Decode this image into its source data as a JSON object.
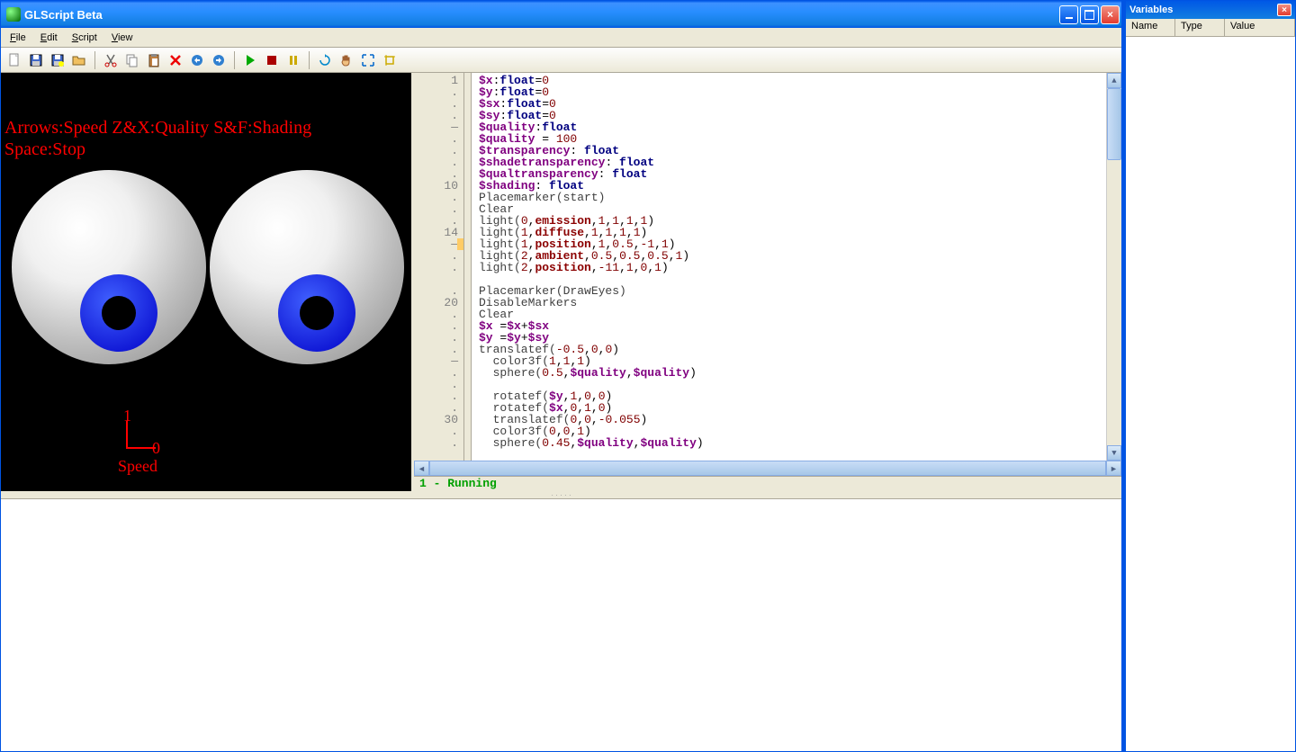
{
  "title": "GLScript Beta",
  "menu": {
    "file": "File",
    "edit": "Edit",
    "script": "Script",
    "view": "View"
  },
  "overlay": {
    "line1": "Arrows:Speed  Z&X:Quality   S&F:Shading",
    "line2": "Space:Stop",
    "axis_y": "1",
    "axis_x": "0",
    "axis_label": "Speed"
  },
  "gutter": [
    "1",
    ".",
    ".",
    ".",
    "—",
    ".",
    ".",
    ".",
    ".",
    "10",
    ".",
    ".",
    ".",
    "14",
    "—",
    ".",
    ".",
    "",
    ".",
    "20",
    ".",
    ".",
    ".",
    ".",
    "—",
    ".",
    ".",
    ".",
    ".",
    "30",
    ".",
    "."
  ],
  "codeLines": [
    [
      [
        "k-var",
        "$x"
      ],
      [
        "",
        ":"
      ],
      [
        "k-type",
        "float"
      ],
      [
        "",
        "="
      ],
      [
        "k-num",
        "0"
      ]
    ],
    [
      [
        "k-var",
        "$y"
      ],
      [
        "",
        ":"
      ],
      [
        "k-type",
        "float"
      ],
      [
        "",
        "="
      ],
      [
        "k-num",
        "0"
      ]
    ],
    [
      [
        "k-var",
        "$sx"
      ],
      [
        "",
        ":"
      ],
      [
        "k-type",
        "float"
      ],
      [
        "",
        "="
      ],
      [
        "k-num",
        "0"
      ]
    ],
    [
      [
        "k-var",
        "$sy"
      ],
      [
        "",
        ":"
      ],
      [
        "k-type",
        "float"
      ],
      [
        "",
        "="
      ],
      [
        "k-num",
        "0"
      ]
    ],
    [
      [
        "k-var",
        "$quality"
      ],
      [
        "",
        ":"
      ],
      [
        "k-type",
        "float"
      ]
    ],
    [
      [
        "k-var",
        "$quality"
      ],
      [
        "",
        " = "
      ],
      [
        "k-num",
        "100"
      ]
    ],
    [
      [
        "k-var",
        "$transparency"
      ],
      [
        "",
        ": "
      ],
      [
        "k-type",
        "float"
      ]
    ],
    [
      [
        "k-var",
        "$shadetransparency"
      ],
      [
        "",
        ": "
      ],
      [
        "k-type",
        "float"
      ]
    ],
    [
      [
        "k-var",
        "$qualtransparency"
      ],
      [
        "",
        ": "
      ],
      [
        "k-type",
        "float"
      ]
    ],
    [
      [
        "k-var",
        "$shading"
      ],
      [
        "",
        ": "
      ],
      [
        "k-type",
        "float"
      ]
    ],
    [
      [
        "k-id",
        "Placemarker(start)"
      ]
    ],
    [
      [
        "k-id",
        "Clear"
      ]
    ],
    [
      [
        "k-id",
        "light("
      ],
      [
        "k-num",
        "0"
      ],
      [
        "",
        ","
      ],
      [
        "k-kw",
        "emission"
      ],
      [
        "",
        ","
      ],
      [
        "k-num",
        "1"
      ],
      [
        "",
        ","
      ],
      [
        "k-num",
        "1"
      ],
      [
        "",
        ","
      ],
      [
        "k-num",
        "1"
      ],
      [
        "",
        ","
      ],
      [
        "k-num",
        "1"
      ],
      [
        "",
        ")"
      ]
    ],
    [
      [
        "k-id",
        "light("
      ],
      [
        "k-num",
        "1"
      ],
      [
        "",
        ","
      ],
      [
        "k-kw",
        "diffuse"
      ],
      [
        "",
        ","
      ],
      [
        "k-num",
        "1"
      ],
      [
        "",
        ","
      ],
      [
        "k-num",
        "1"
      ],
      [
        "",
        ","
      ],
      [
        "k-num",
        "1"
      ],
      [
        "",
        ","
      ],
      [
        "k-num",
        "1"
      ],
      [
        "",
        ")"
      ]
    ],
    [
      [
        "k-id",
        "light("
      ],
      [
        "k-num",
        "1"
      ],
      [
        "",
        ","
      ],
      [
        "k-kw",
        "position"
      ],
      [
        "",
        ","
      ],
      [
        "k-num",
        "1"
      ],
      [
        "",
        ","
      ],
      [
        "k-num",
        "0.5"
      ],
      [
        "",
        ","
      ],
      [
        "k-num",
        "-1"
      ],
      [
        "",
        ","
      ],
      [
        "k-num",
        "1"
      ],
      [
        "",
        ")"
      ]
    ],
    [
      [
        "k-id",
        "light("
      ],
      [
        "k-num",
        "2"
      ],
      [
        "",
        ","
      ],
      [
        "k-kw",
        "ambient"
      ],
      [
        "",
        ","
      ],
      [
        "k-num",
        "0.5"
      ],
      [
        "",
        ","
      ],
      [
        "k-num",
        "0.5"
      ],
      [
        "",
        ","
      ],
      [
        "k-num",
        "0.5"
      ],
      [
        "",
        ","
      ],
      [
        "k-num",
        "1"
      ],
      [
        "",
        ")"
      ]
    ],
    [
      [
        "k-id",
        "light("
      ],
      [
        "k-num",
        "2"
      ],
      [
        "",
        ","
      ],
      [
        "k-kw",
        "position"
      ],
      [
        "",
        ","
      ],
      [
        "k-num",
        "-11"
      ],
      [
        "",
        ","
      ],
      [
        "k-num",
        "1"
      ],
      [
        "",
        ","
      ],
      [
        "k-num",
        "0"
      ],
      [
        "",
        ","
      ],
      [
        "k-num",
        "1"
      ],
      [
        "",
        ")"
      ]
    ],
    [
      [
        "",
        ""
      ]
    ],
    [
      [
        "k-id",
        "Placemarker(DrawEyes)"
      ]
    ],
    [
      [
        "k-id",
        "DisableMarkers"
      ]
    ],
    [
      [
        "k-id",
        "Clear"
      ]
    ],
    [
      [
        "k-var",
        "$x"
      ],
      [
        "",
        " ="
      ],
      [
        "k-var",
        "$x"
      ],
      [
        "",
        "+"
      ],
      [
        "k-var",
        "$sx"
      ]
    ],
    [
      [
        "k-var",
        "$y"
      ],
      [
        "",
        " ="
      ],
      [
        "k-var",
        "$y"
      ],
      [
        "",
        "+"
      ],
      [
        "k-var",
        "$sy"
      ]
    ],
    [
      [
        "k-id",
        "translatef("
      ],
      [
        "k-num",
        "-0.5"
      ],
      [
        "",
        ","
      ],
      [
        "k-num",
        "0"
      ],
      [
        "",
        ","
      ],
      [
        "k-num",
        "0"
      ],
      [
        "",
        ")"
      ]
    ],
    [
      [
        "",
        "  "
      ],
      [
        "k-id",
        "color3f("
      ],
      [
        "k-num",
        "1"
      ],
      [
        "",
        ","
      ],
      [
        "k-num",
        "1"
      ],
      [
        "",
        ","
      ],
      [
        "k-num",
        "1"
      ],
      [
        "",
        ")"
      ]
    ],
    [
      [
        "",
        "  "
      ],
      [
        "k-id",
        "sphere("
      ],
      [
        "k-num",
        "0.5"
      ],
      [
        "",
        ","
      ],
      [
        "k-var",
        "$quality"
      ],
      [
        "",
        ","
      ],
      [
        "k-var",
        "$quality"
      ],
      [
        "",
        ")"
      ]
    ],
    [
      [
        "",
        ""
      ]
    ],
    [
      [
        "",
        "  "
      ],
      [
        "k-id",
        "rotatef("
      ],
      [
        "k-var",
        "$y"
      ],
      [
        "",
        ","
      ],
      [
        "k-num",
        "1"
      ],
      [
        "",
        ","
      ],
      [
        "k-num",
        "0"
      ],
      [
        "",
        ","
      ],
      [
        "k-num",
        "0"
      ],
      [
        "",
        ")"
      ]
    ],
    [
      [
        "",
        "  "
      ],
      [
        "k-id",
        "rotatef("
      ],
      [
        "k-var",
        "$x"
      ],
      [
        "",
        ","
      ],
      [
        "k-num",
        "0"
      ],
      [
        "",
        ","
      ],
      [
        "k-num",
        "1"
      ],
      [
        "",
        ","
      ],
      [
        "k-num",
        "0"
      ],
      [
        "",
        ")"
      ]
    ],
    [
      [
        "",
        "  "
      ],
      [
        "k-id",
        "translatef("
      ],
      [
        "k-num",
        "0"
      ],
      [
        "",
        ","
      ],
      [
        "k-num",
        "0"
      ],
      [
        "",
        ","
      ],
      [
        "k-num",
        "-0.055"
      ],
      [
        "",
        ")"
      ]
    ],
    [
      [
        "",
        "  "
      ],
      [
        "k-id",
        "color3f("
      ],
      [
        "k-num",
        "0"
      ],
      [
        "",
        ","
      ],
      [
        "k-num",
        "0"
      ],
      [
        "",
        ","
      ],
      [
        "k-num",
        "1"
      ],
      [
        "",
        ")"
      ]
    ],
    [
      [
        "",
        "  "
      ],
      [
        "k-id",
        "sphere("
      ],
      [
        "k-num",
        "0.45"
      ],
      [
        "",
        ","
      ],
      [
        "k-var",
        "$quality"
      ],
      [
        "",
        ","
      ],
      [
        "k-var",
        "$quality"
      ],
      [
        "",
        ")"
      ]
    ]
  ],
  "status": "1 - Running",
  "variables": {
    "title": "Variables",
    "cols": {
      "name": "Name",
      "type": "Type",
      "value": "Value"
    }
  }
}
